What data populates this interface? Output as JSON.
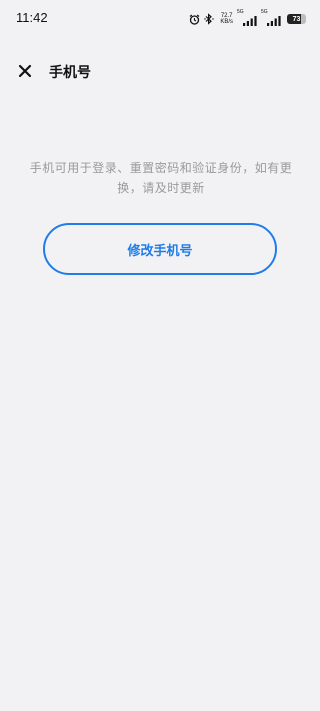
{
  "status_bar": {
    "time": "11:42",
    "net_speed_value": "72.7",
    "net_speed_unit": "KB/s",
    "sim1_tag": "5G",
    "sim2_tag": "5G",
    "battery_level": "73",
    "icons": [
      "alarm-icon",
      "bluetooth-icon",
      "signal-icon",
      "signal-icon",
      "battery-icon"
    ]
  },
  "header": {
    "title": "手机号",
    "close_icon": "close-icon"
  },
  "main": {
    "hint": "手机可用于登录、重置密码和验证身份，如有更换，请及时更新",
    "modify_button_label": "修改手机号"
  },
  "colors": {
    "background": "#f2f2f4",
    "accent": "#1f7ce8",
    "hint_text": "#9a9a9a",
    "title_text": "#111111"
  }
}
